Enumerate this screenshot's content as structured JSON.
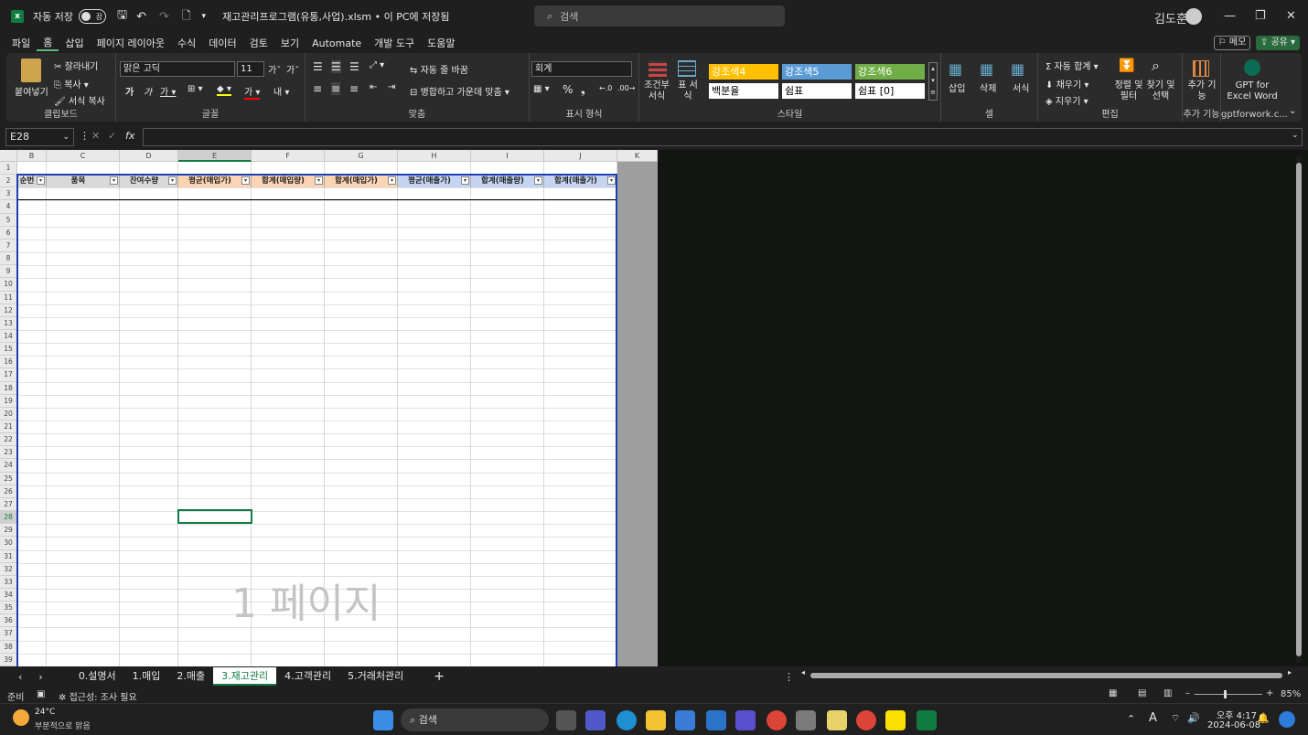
{
  "titlebar": {
    "autosave_label": "자동 저장",
    "autosave_state": "끔",
    "filename": "재고관리프로그램(유통,사업).xlsm • 이 PC에 저장됨",
    "search_placeholder": "검색",
    "user": "김도훈"
  },
  "menu": [
    "파일",
    "홈",
    "삽입",
    "페이지 레이아웃",
    "수식",
    "데이터",
    "검토",
    "보기",
    "Automate",
    "개발 도구",
    "도움말"
  ],
  "menu_right": {
    "memo": "메모",
    "share": "공유"
  },
  "ribbon": {
    "clipboard": {
      "paste": "붙여넣기",
      "cut": "잘라내기",
      "copy": "복사",
      "format_painter": "서식 복사",
      "label": "클립보드"
    },
    "font": {
      "name": "맑은 고딕",
      "size": "11",
      "label": "글꼴"
    },
    "align": {
      "wrap": "자동 줄 바꿈",
      "merge": "병합하고 가운데 맞춤",
      "label": "맞춤"
    },
    "number": {
      "format": "회계",
      "label": "표시 형식"
    },
    "styles": {
      "cond": "조건부 서식",
      "table": "표 서식",
      "cells": [
        "강조색4",
        "강조색5",
        "강조색6",
        "백분율",
        "쉼표",
        "쉼표 [0]"
      ],
      "label": "스타일"
    },
    "cells": {
      "insert": "삽입",
      "delete": "삭제",
      "format": "서식",
      "label": "셀"
    },
    "edit": {
      "autosum": "자동 합계",
      "fill": "채우기",
      "clear": "지우기",
      "sort": "정렬 및 필터",
      "find": "찾기 및 선택",
      "label": "편집"
    },
    "addins": {
      "add": "추가 기능",
      "gpt": "GPT for Excel Word",
      "label1": "추가 기능",
      "label2": "gptforwork.c..."
    }
  },
  "formula": {
    "namebox": "E28",
    "fx": "fx",
    "content": ""
  },
  "sheet": {
    "columns": [
      "B",
      "C",
      "D",
      "E",
      "F",
      "G",
      "H",
      "I",
      "J",
      "K"
    ],
    "rows": [
      "1",
      "2",
      "3",
      "4",
      "5",
      "6",
      "7",
      "8",
      "9",
      "10",
      "11",
      "12",
      "13",
      "14",
      "15",
      "16",
      "17",
      "18",
      "19",
      "20",
      "21",
      "22",
      "23",
      "24",
      "25",
      "26",
      "27",
      "28",
      "29",
      "30",
      "31",
      "32",
      "33",
      "34",
      "35",
      "36",
      "37",
      "38",
      "39"
    ],
    "headers": [
      "순번",
      "품목",
      "잔여수량",
      "평균(매입가)",
      "합계(매입량)",
      "합계(매입가)",
      "평균(매출가)",
      "합계(매출량)",
      "합계(매출가)"
    ],
    "watermark": "1 페이지"
  },
  "tabs": [
    "0.설명서",
    "1.매입",
    "2.매출",
    "3.재고관리",
    "4.고객관리",
    "5.거래처관리"
  ],
  "active_tab": "3.재고관리",
  "status": {
    "ready": "준비",
    "accessibility": "접근성: 조사 필요",
    "zoom": "85%"
  },
  "taskbar": {
    "weather_temp": "24°C",
    "weather_desc": "부분적으로 맑음",
    "search": "검색",
    "time": "오후 4:17",
    "date": "2024-06-08"
  },
  "colors": {
    "accent4": "#ffc000",
    "accent5": "#5b9bd5",
    "accent6": "#70ad47",
    "header_orange": "#fbd4b4",
    "header_blue": "#c5d4f0",
    "excel_green": "#107c41"
  }
}
